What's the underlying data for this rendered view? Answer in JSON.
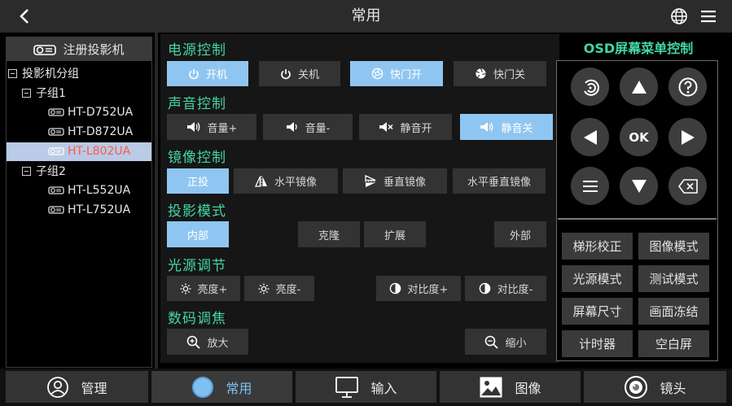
{
  "header": {
    "title": "常用"
  },
  "sidebar": {
    "register_label": "注册投影机",
    "group_label": "投影机分组",
    "subgroups": [
      {
        "label": "子组1",
        "devices": [
          "HT-D752UA",
          "HT-D872UA",
          "HT-L802UA"
        ]
      },
      {
        "label": "子组2",
        "devices": [
          "HT-L552UA",
          "HT-L752UA"
        ]
      }
    ],
    "selected_device": "HT-L802UA",
    "selected_color": "#ff5a4a"
  },
  "sections": {
    "power": {
      "title": "电源控制",
      "buttons": [
        "开机",
        "关机",
        "快门开",
        "快门关"
      ]
    },
    "sound": {
      "title": "声音控制",
      "buttons": [
        "音量+",
        "音量-",
        "静音开",
        "静音关"
      ]
    },
    "mirror": {
      "title": "镜像控制",
      "buttons": [
        "正投",
        "水平镜像",
        "垂直镜像",
        "水平垂直镜像"
      ]
    },
    "mode": {
      "title": "投影模式",
      "buttons": [
        "内部",
        "克隆",
        "扩展",
        "外部"
      ]
    },
    "light": {
      "title": "光源调节",
      "buttons": [
        "亮度+",
        "亮度-",
        "对比度+",
        "对比度-"
      ]
    },
    "zoom": {
      "title": "数码调焦",
      "buttons": [
        "放大",
        "缩小"
      ]
    }
  },
  "osd": {
    "title": "OSD屏幕菜单控制",
    "ok_label": "OK",
    "buttons": [
      "梯形校正",
      "图像模式",
      "光源模式",
      "测试模式",
      "屏幕尺寸",
      "画面冻结",
      "计时器",
      "空白屏"
    ]
  },
  "tabs": [
    {
      "label": "管理",
      "icon": "user-icon"
    },
    {
      "label": "常用",
      "icon": "circle-icon",
      "active": true
    },
    {
      "label": "输入",
      "icon": "monitor-icon"
    },
    {
      "label": "图像",
      "icon": "image-icon"
    },
    {
      "label": "镜头",
      "icon": "lens-icon"
    }
  ],
  "colors": {
    "accent_green": "#43d6a3",
    "active_blue": "#8fc6f1",
    "tab_active": "#7fc0f2"
  }
}
